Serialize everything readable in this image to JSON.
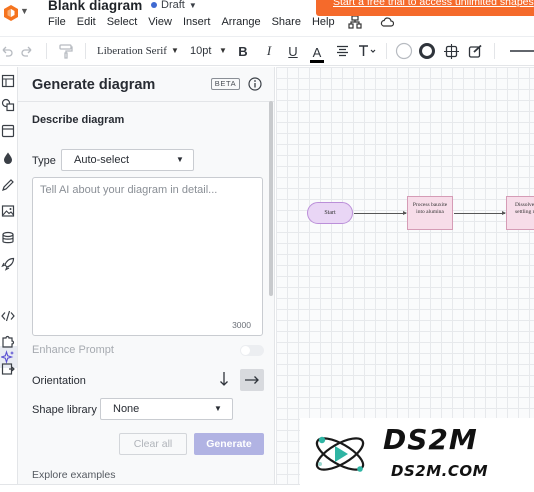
{
  "header": {
    "title": "Blank diagram",
    "status": "Draft",
    "trial_banner": "Start a free trial to access unlimited shapes",
    "menu": [
      "File",
      "Edit",
      "Select",
      "View",
      "Insert",
      "Arrange",
      "Share",
      "Help"
    ],
    "menu_icons": [
      "sitemap-icon",
      "cloud-icon"
    ]
  },
  "toolbar": {
    "font_family": "Liberation Serif",
    "font_size": "10pt",
    "bold": "B",
    "italic": "I",
    "underline": "U",
    "text_color": "A",
    "text_color_value": "#000000"
  },
  "rail": {
    "icons": [
      "page-icon",
      "shapes-icon",
      "template-icon",
      "fill-icon",
      "draw-icon",
      "image-icon",
      "data-icon",
      "rocket-icon",
      "ai-sparkle-icon",
      "code-icon",
      "integration-icon",
      "export-icon"
    ],
    "active": "ai-sparkle-icon"
  },
  "panel": {
    "title": "Generate diagram",
    "badge": "BETA",
    "section_title": "Describe diagram",
    "type_label": "Type",
    "type_value": "Auto-select",
    "prompt_placeholder": "Tell AI about your diagram in detail...",
    "char_limit": "3000",
    "enhance_label": "Enhance Prompt",
    "enhance_enabled": false,
    "orientation_label": "Orientation",
    "orientation_selected": "horizontal",
    "shape_library_label": "Shape library",
    "shape_library_value": "None",
    "clear_label": "Clear all",
    "generate_label": "Generate",
    "generate_color": "#b1b3e3",
    "explore_label": "Explore examples"
  },
  "canvas": {
    "nodes": [
      {
        "id": "start",
        "label": "Start"
      },
      {
        "id": "n1",
        "label": "Process bauxite into alumina"
      },
      {
        "id": "n2",
        "label": "Dissolve settling roasti"
      }
    ]
  },
  "watermark": {
    "name": "DS2M",
    "url": "DS2M.COM"
  }
}
